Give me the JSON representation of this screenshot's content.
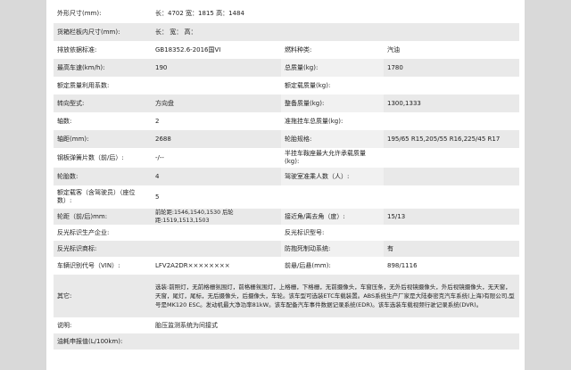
{
  "rows": [
    {
      "label": "外形尺寸(mm):",
      "value": "长：4702 宽：1815 高：1484"
    },
    {
      "label": "货箱栏板内尺寸(mm):",
      "value": "长：  宽：  高："
    },
    {
      "label": "排放依据标准:",
      "value": "GB18352.6-2016国VI",
      "label2": "燃料种类:",
      "value2": "汽油"
    },
    {
      "label": "最高车速(km/h):",
      "value": "190",
      "label2": "总质量(kg):",
      "value2": "1780"
    },
    {
      "label": "额定质量利用系数:",
      "value": "",
      "label2": "额定载质量(kg):",
      "value2": ""
    },
    {
      "label": "转向型式:",
      "value": "方向盘",
      "label2": "整备质量(kg):",
      "value2": "1300,1333"
    },
    {
      "label": "轴数:",
      "value": "2",
      "label2": "准拖挂车总质量(kg):",
      "value2": ""
    },
    {
      "label": "轴距(mm):",
      "value": "2688",
      "label2": "轮胎规格:",
      "value2": "195/65 R15,205/55 R16,225/45 R17"
    },
    {
      "label": "钢板弹簧片数（前/后）:",
      "value": "-/--",
      "label2": "半挂车鞍座最大允许承载质量(kg):",
      "value2": ""
    },
    {
      "label": "轮胎数:",
      "value": "4",
      "label2": "驾驶室准乘人数（人）:",
      "value2": ""
    },
    {
      "label": "额定载客（含驾驶员）（座位数）:",
      "value": "5"
    },
    {
      "label": "轮距（前/后)mm:",
      "value": "前轮距:1546,1540,1530 后轮距:1519,1513,1503",
      "label2": "接近角/离去角（度）:",
      "value2": "15/13"
    },
    {
      "label": "反光标识生产企业:",
      "value": "",
      "label2": "反光标识型号:",
      "value2": ""
    },
    {
      "label": "反光标识商标:",
      "value": "",
      "label2": "防抱死制动系统:",
      "value2": "有"
    },
    {
      "label": "车辆识别代号（VIN）:",
      "value": "LFV2A2DR××××××××",
      "label2": "前悬/后悬(mm):",
      "value2": "898/1116"
    },
    {
      "label": "其它:",
      "value": "选装:前照灯，无前格栅氛围灯，前格栅氛围灯，上格栅，下格栅，无前摄像头，车窗压条，无外后视镜摄像头，外后视镜摄像头，无天窗，天窗，尾灯，尾标，无后摄像头，后摄像头，车轮。该车型可选装ETC车载装置。ABS系统生产厂家是大陆泰密克汽车系统(上海)有限公司,型号是MK120 ESC。发动机最大净功率81kW。该车配备汽车事件数据记录系统(EDR)。该车选装车载视频行驶记录系统(DVR)。"
    },
    {
      "label": "说明:",
      "value": "胎压监测系统为间接式"
    },
    {
      "label": "油耗申报值(L/100km):",
      "value": ""
    }
  ]
}
